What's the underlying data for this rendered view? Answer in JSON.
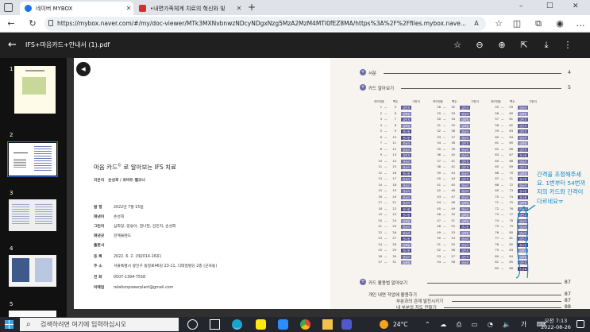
{
  "browser": {
    "tabs": [
      {
        "title": "네이버 MYBOX",
        "active": true,
        "icon": "mybox-icon",
        "icon_color": "#1a73e8"
      },
      {
        "title": "•내면가족체계 치료의 혁신와 빛",
        "active": false,
        "icon": "pdf-icon",
        "icon_color": "#d32f2f"
      }
    ],
    "new_tab": "+",
    "url": "https://mybox.naver.com/#/my/doc-viewer/MTk3MXNvbnwzNDcyNDgxNzg5MzA2MzM4MTI0fEZ8MA/https%3A%2F%2Ffiles.mybox.nave...",
    "window_controls": [
      "–",
      "□",
      "✕"
    ]
  },
  "viewer": {
    "title": "IFS+마음카드+안내서 (1).pdf",
    "back": "←",
    "thumbnail_pages": [
      "1",
      "2",
      "3",
      "4",
      "5"
    ],
    "selected_page": "2"
  },
  "left_page": {
    "book_title": "마음 카드",
    "book_sup": "©",
    "book_title_rest": " 로 알아보는 IFS 치료",
    "authors": "지은이   손성회 / 로버트 팰코너",
    "credits": [
      {
        "label": "발  행",
        "value": "2022년 7월 15일"
      },
      {
        "label": "펴낸이",
        "value": "손성회"
      },
      {
        "label": "그린이",
        "value": "심희망, 양승아, 권나현, 김민지, 손성회"
      },
      {
        "label": "펴낸곳",
        "value": "관계블렌드"
      },
      {
        "label": "출판사",
        "value": ""
      },
      {
        "label": "등  록",
        "value": "2022. 6. 2. (제2014-16호)"
      },
      {
        "label": "주  소",
        "value": "서울특별시 광진구 동일로46길 23-11, 디테일빌딩 2층 (군자동)"
      },
      {
        "label": "전  화",
        "value": "0507-1394-7558"
      },
      {
        "label": "이메일",
        "value": "relationpowerplant@gmail.com"
      }
    ]
  },
  "right_page": {
    "toc": [
      {
        "title": "서문",
        "page": "4"
      },
      {
        "title": "카드 알아보기",
        "page": "5"
      },
      {
        "title": "카드 활용법 알아보기",
        "page": "87"
      },
      {
        "title": "개인 내면 작업에 활용하기",
        "page": "87"
      },
      {
        "title": "부분과의 관계 발전시키기",
        "page": "87"
      },
      {
        "title": "내 부분의 지도 만들기",
        "page": "88"
      }
    ],
    "card_headers": [
      "카드번호",
      "쪽수",
      "그린이"
    ],
    "card_columns": [
      {
        "nums": [
          "1",
          "2",
          "3",
          "4",
          "5",
          "6",
          "7",
          "8",
          "9",
          "10",
          "11",
          "12",
          "13",
          "14",
          "15",
          "16",
          "17",
          "18",
          "19",
          "20",
          "21",
          "22",
          "23",
          "24",
          "25",
          "26",
          "27"
        ],
        "pages": [
          "5",
          "6",
          "7",
          "8",
          "9",
          "10",
          "11",
          "12",
          "13",
          "14",
          "15",
          "16",
          "17",
          "18",
          "19",
          "20",
          "21",
          "22",
          "23",
          "24",
          "25",
          "26",
          "27",
          "28",
          "29",
          "30",
          "31"
        ],
        "artists": [
          "김민지",
          "심희망",
          "김민지",
          "심희망",
          "권나현",
          "권나현",
          "양승아",
          "양승아",
          "김민지",
          "양승아",
          "양승아",
          "권나현",
          "양승아",
          "양승아",
          "양승아",
          "양승아",
          "양승아",
          "권나현",
          "권나현",
          "심희망",
          "양승아",
          "양승아",
          "권나현",
          "심희망",
          "권나현",
          "양승아",
          "심희망"
        ]
      },
      {
        "nums": [
          "28",
          "29",
          "30",
          "31",
          "32",
          "33",
          "34",
          "35",
          "36",
          "37",
          "38",
          "39",
          "40",
          "41",
          "42",
          "43",
          "44",
          "45",
          "46",
          "47",
          "48",
          "49",
          "50",
          "51",
          "52",
          "53",
          "54"
        ],
        "pages": [
          "32",
          "33",
          "34",
          "35",
          "36",
          "37",
          "38",
          "39",
          "40",
          "41",
          "42",
          "43",
          "44",
          "45",
          "46",
          "47",
          "48",
          "49",
          "50",
          "51",
          "52",
          "53",
          "54",
          "55",
          "56",
          "57",
          "58"
        ],
        "artists": [
          "김민지",
          "양승아",
          "심희망",
          "심희망",
          "양승아",
          "양승아",
          "김민지",
          "양승아",
          "양승아",
          "김민지",
          "김민지",
          "양승아",
          "김민지",
          "양승아",
          "양승아",
          "양승아",
          "심희망",
          "양승아",
          "심희망",
          "심희망",
          "권나현",
          "심희망",
          "양승아",
          "양승아",
          "김민지",
          "김민지",
          "양승아"
        ]
      },
      {
        "nums": [
          "55",
          "56",
          "57",
          "58",
          "59",
          "60",
          "61",
          "62",
          "63",
          "64",
          "65",
          "66",
          "67",
          "68",
          "69",
          "70",
          "71",
          "72",
          "73",
          "74",
          "75",
          "76",
          "77",
          "78",
          "79",
          "80",
          "81",
          "82"
        ],
        "pages": [
          "59",
          "60",
          "61",
          "62",
          "63",
          "64",
          "65",
          "66",
          "67",
          "68",
          "69",
          "70",
          "71",
          "72",
          "73",
          "74",
          "75",
          "76",
          "77",
          "78",
          "79",
          "80",
          "81",
          "82",
          "83",
          "84",
          "85",
          "86"
        ],
        "artists": [
          "양승아",
          "심희망",
          "김민지",
          "김민지",
          "김민지",
          "양승아",
          "심희망",
          "김민지",
          "권나현",
          "양승아",
          "김민지",
          "심희망",
          "권나현",
          "양승아",
          "권나현",
          "권나현",
          "심희망",
          "양승아",
          "김민지",
          "양승아",
          "양승아",
          "양승아",
          "김민지",
          "권나현",
          "심희망",
          "심희망",
          "김민지",
          "손성회"
        ]
      }
    ]
  },
  "annotation": {
    "text": "간격을 조정해주세요. 1번부터 54번까지의 카드와 간격이 다르네요ㅠ",
    "color": "#0b88c9"
  },
  "taskbar": {
    "search_placeholder": "검색하려면 여기에 입력하십시오",
    "weather": "24°C",
    "time": "오전 7:13",
    "date": "2022-08-26"
  }
}
